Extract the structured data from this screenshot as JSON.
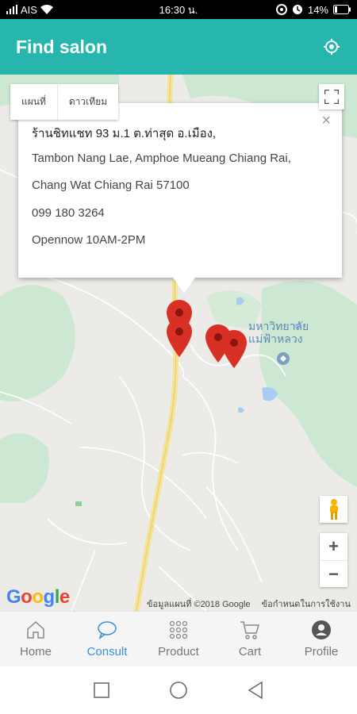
{
  "status_bar": {
    "carrier": "AIS",
    "time": "16:30 น.",
    "battery": "14%"
  },
  "header": {
    "title": "Find salon",
    "locate_icon": "locate-icon"
  },
  "map": {
    "type_buttons": [
      "แผนที่",
      "ดาวเทียม"
    ],
    "place_label_line1": "มหาวิทยาลัย",
    "place_label_line2": "แม่ฟ้าหลวง",
    "info_window": {
      "line1": "ร้านชิทแชท 93 ม.1 ต.ท่าสุด อ.เมือง,",
      "line2": "Tambon Nang Lae, Amphoe Mueang Chiang Rai,",
      "line3": "Chang Wat Chiang Rai 57100",
      "phone": "099 180 3264",
      "hours": "Opennow 10AM-2PM",
      "close_glyph": "×"
    },
    "zoom_in": "+",
    "zoom_out": "−",
    "logo": "Google",
    "attribution": "ข้อมูลแผนที่ ©2018 Google",
    "terms": "ข้อกำหนดในการใช้งาน"
  },
  "bottom_nav": [
    {
      "label": "Home",
      "icon": "home-icon",
      "active": false
    },
    {
      "label": "Consult",
      "icon": "chat-bubble-icon",
      "active": true
    },
    {
      "label": "Product",
      "icon": "grid-dots-icon",
      "active": false
    },
    {
      "label": "Cart",
      "icon": "cart-icon",
      "active": false
    },
    {
      "label": "Profile",
      "icon": "profile-icon",
      "active": false
    }
  ],
  "colors": {
    "header": "#26b6ad",
    "active_nav": "#3a8fd6",
    "pin": "#d93025"
  }
}
